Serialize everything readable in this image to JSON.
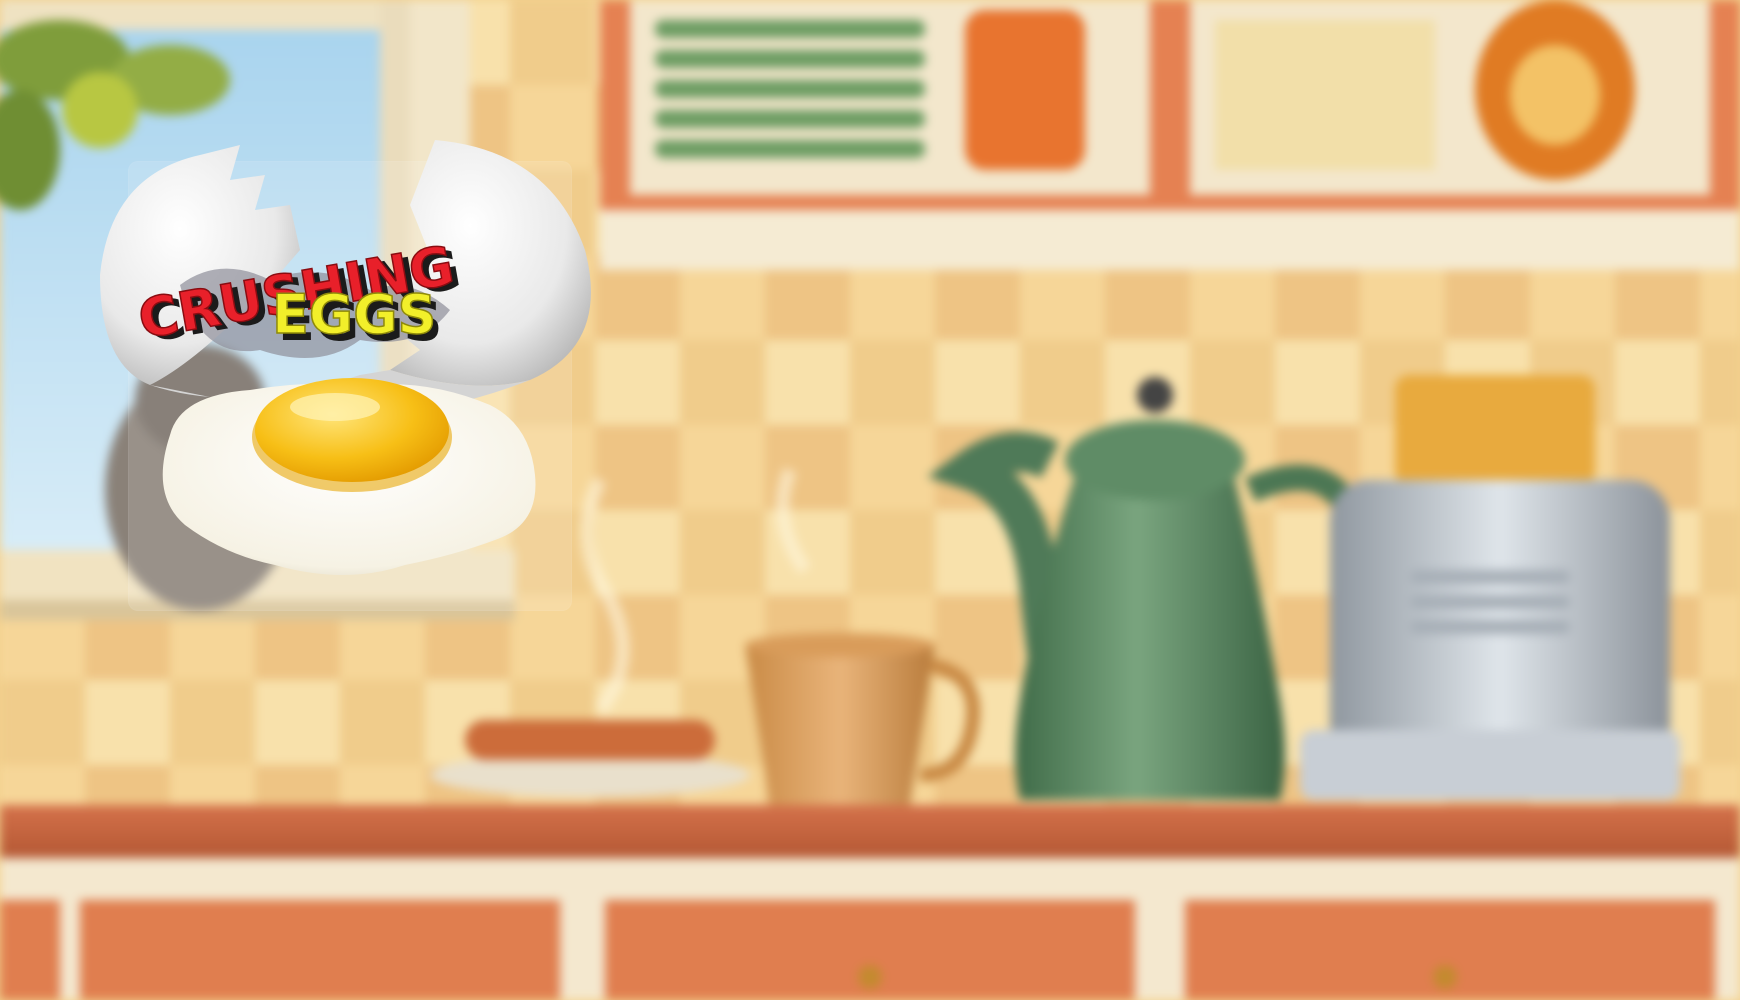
{
  "game": {
    "title_line1": "CRUSHING",
    "title_line2": "EGGS"
  },
  "colors": {
    "wall_light": "#f6dca3",
    "wall_tile": "#e9c27e",
    "cabinet_orange": "#e07e4f",
    "counter_top": "#c9643d",
    "title_line1_fill": "#e8202a",
    "title_line2_fill": "#f2ef2a",
    "title_shadow": "#1a1a1a",
    "egg_yolk": "#f6bd16",
    "egg_white": "#fbf8ef",
    "kettle_green": "#5e8a64",
    "toaster_silver": "#b9c0c7"
  },
  "scene": {
    "objects": [
      "window-with-apple-tree",
      "wall-cabinets",
      "flour-jar",
      "maple-syrup-bottle",
      "plate-stack",
      "kettle",
      "toaster",
      "toast",
      "coffee-cup",
      "sausage-plate",
      "lower-cabinets",
      "cat"
    ]
  }
}
